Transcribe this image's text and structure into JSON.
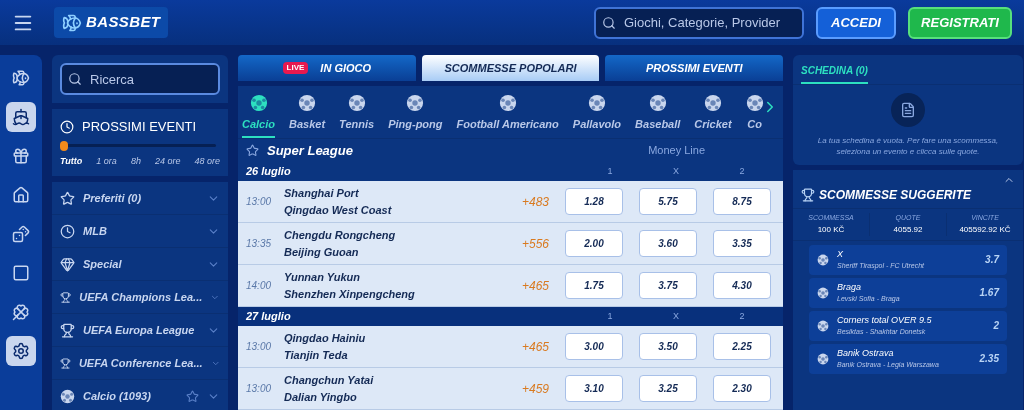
{
  "header": {
    "logo": "BASSBET",
    "search": {
      "placeholder": "Giochi, Categorie, Provider"
    },
    "buttons": [
      {
        "label": "ACCEDI",
        "kind": "login"
      },
      {
        "label": "REGISTRATI",
        "kind": "register"
      }
    ]
  },
  "rail": [
    {
      "selected": false
    },
    {
      "selected": true
    },
    {
      "selected": false
    },
    {
      "selected": false
    },
    {
      "selected": false
    },
    {
      "selected": false
    },
    {
      "selected": false
    },
    {
      "selected": true
    }
  ],
  "sidebar": {
    "search": {
      "placeholder": "Ricerca"
    },
    "upcoming": {
      "title": "PROSSIMI EVENTI",
      "level": 0,
      "options": [
        {
          "label": "Tutto",
          "selected": true
        },
        {
          "label": "1 ora",
          "selected": false
        },
        {
          "label": "8h",
          "selected": false
        },
        {
          "label": "24 ore",
          "selected": false
        },
        {
          "label": "48 ore",
          "selected": false
        }
      ]
    },
    "items": [
      {
        "label": "Preferiti (0)",
        "star": false
      },
      {
        "label": "MLB",
        "star": false
      },
      {
        "label": "Special",
        "star": false
      },
      {
        "label": "UEFA Champions Lea...",
        "star": false
      },
      {
        "label": "UEFA Europa League",
        "star": false
      },
      {
        "label": "UEFA Conference Lea...",
        "star": false
      },
      {
        "label": "Calcio (1093)",
        "star": true
      }
    ]
  },
  "tabs": [
    {
      "label": "IN GIOCO",
      "badge": "LIVE",
      "selected": false
    },
    {
      "label": "SCOMMESSE POPOLARI",
      "selected": true
    },
    {
      "label": "PROSSIMI EVENTI",
      "selected": false
    }
  ],
  "sports": [
    {
      "label": "Calcio",
      "selected": true
    },
    {
      "label": "Basket",
      "selected": false
    },
    {
      "label": "Tennis",
      "selected": false
    },
    {
      "label": "Ping-pong",
      "selected": false
    },
    {
      "label": "Football Americano",
      "selected": false
    },
    {
      "label": "Pallavolo",
      "selected": false
    },
    {
      "label": "Baseball",
      "selected": false
    },
    {
      "label": "Cricket",
      "selected": false
    },
    {
      "label": "Co",
      "selected": false
    }
  ],
  "league": {
    "title": "Super League",
    "market": "Money Line"
  },
  "groups": [
    {
      "date": "26 luglio",
      "columns": [
        "1",
        "X",
        "2"
      ],
      "matches": [
        {
          "time": "13:00",
          "home": "Shanghai Port",
          "away": "Qingdao West Coast",
          "more": "+483",
          "odds": [
            "1.28",
            "5.75",
            "8.75"
          ]
        },
        {
          "time": "13:35",
          "home": "Chengdu Rongcheng",
          "away": "Beijing Guoan",
          "more": "+556",
          "odds": [
            "2.00",
            "3.60",
            "3.35"
          ]
        },
        {
          "time": "14:00",
          "home": "Yunnan Yukun",
          "away": "Shenzhen Xinpengcheng",
          "more": "+465",
          "odds": [
            "1.75",
            "3.75",
            "4.30"
          ]
        }
      ]
    },
    {
      "date": "27 luglio",
      "columns": [
        "1",
        "X",
        "2"
      ],
      "matches": [
        {
          "time": "13:00",
          "home": "Qingdao Hainiu",
          "away": "Tianjin Teda",
          "more": "+465",
          "odds": [
            "3.00",
            "3.50",
            "2.25"
          ]
        },
        {
          "time": "13:00",
          "home": "Changchun Yatai",
          "away": "Dalian Yingbo",
          "more": "+459",
          "odds": [
            "3.10",
            "3.25",
            "2.30"
          ]
        }
      ]
    }
  ],
  "betslip": {
    "tab": "SCHEDINA (0)",
    "empty_text": "La tua schedina è vuota. Per fare una scommessa, seleziona un evento e clicca sulle quote."
  },
  "suggested": {
    "title": "SCOMMESSE SUGGERITE",
    "stats": [
      {
        "label": "SCOMMESSA",
        "value": "100 KČ"
      },
      {
        "label": "QUOTE",
        "value": "4055.92"
      },
      {
        "label": "VINCITE",
        "value": "405592.92 KČ"
      }
    ],
    "items": [
      {
        "pick": "X",
        "match": "Sheriff Tiraspol - FC Utrecht",
        "odds": "3.7"
      },
      {
        "pick": "Braga",
        "match": "Levski Sofia - Braga",
        "odds": "1.67"
      },
      {
        "pick": "Corners total OVER 9.5",
        "match": "Besiktas - Shakhtar Donetsk",
        "odds": "2"
      },
      {
        "pick": "Banik Ostrava",
        "match": "Banik Ostrava - Legia Warszawa",
        "odds": "2.35"
      }
    ]
  }
}
